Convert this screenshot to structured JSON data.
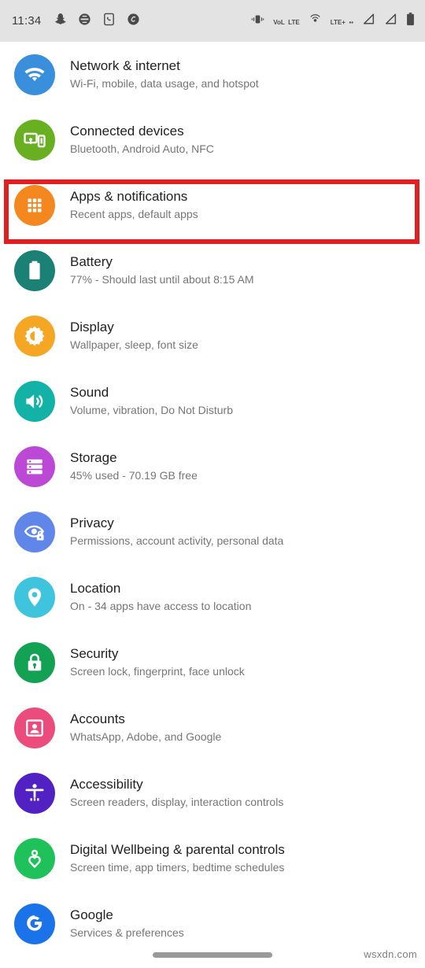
{
  "status_bar": {
    "time": "11:34",
    "left_icons": [
      "snapchat-icon",
      "print-icon",
      "phone-call-icon",
      "shazam-icon"
    ],
    "right_icons": [
      "vibrate-icon",
      "volte-icon",
      "hotspot-icon",
      "lte-plus-icon",
      "signal-sim1-icon",
      "signal-sim2-icon",
      "battery-icon"
    ],
    "volte_top": "VoL",
    "volte_bottom": "LTE",
    "lte_label": "LTE+"
  },
  "highlight": {
    "color": "#e02020",
    "target": "Apps & notifications"
  },
  "settings": {
    "items": [
      {
        "id": "network-internet",
        "title": "Network & internet",
        "subtitle": "Wi-Fi, mobile, data usage, and hotspot",
        "icon": "wifi-icon",
        "color": "#3a8fdd"
      },
      {
        "id": "connected-devices",
        "title": "Connected devices",
        "subtitle": "Bluetooth, Android Auto, NFC",
        "icon": "devices-icon",
        "color": "#68b021"
      },
      {
        "id": "apps-notifications",
        "title": "Apps & notifications",
        "subtitle": "Recent apps, default apps",
        "icon": "apps-grid-icon",
        "color": "#f4881f"
      },
      {
        "id": "battery",
        "title": "Battery",
        "subtitle": "77% - Should last until about 8:15 AM",
        "icon": "battery-icon",
        "color": "#1c8175"
      },
      {
        "id": "display",
        "title": "Display",
        "subtitle": "Wallpaper, sleep, font size",
        "icon": "brightness-icon",
        "color": "#f5a623"
      },
      {
        "id": "sound",
        "title": "Sound",
        "subtitle": "Volume, vibration, Do Not Disturb",
        "icon": "speaker-icon",
        "color": "#12b2a6"
      },
      {
        "id": "storage",
        "title": "Storage",
        "subtitle": "45% used - 70.19 GB free",
        "icon": "storage-icon",
        "color": "#bc49d6"
      },
      {
        "id": "privacy",
        "title": "Privacy",
        "subtitle": "Permissions, account activity, personal data",
        "icon": "eye-lock-icon",
        "color": "#5f86e8"
      },
      {
        "id": "location",
        "title": "Location",
        "subtitle": "On - 34 apps have access to location",
        "icon": "location-pin-icon",
        "color": "#3fc4dd"
      },
      {
        "id": "security",
        "title": "Security",
        "subtitle": "Screen lock, fingerprint, face unlock",
        "icon": "lock-icon",
        "color": "#13a254"
      },
      {
        "id": "accounts",
        "title": "Accounts",
        "subtitle": "WhatsApp, Adobe, and Google",
        "icon": "account-card-icon",
        "color": "#ec4b7e"
      },
      {
        "id": "accessibility",
        "title": "Accessibility",
        "subtitle": "Screen readers, display, interaction controls",
        "icon": "accessibility-icon",
        "color": "#5221c4"
      },
      {
        "id": "digital-wellbeing",
        "title": "Digital Wellbeing & parental controls",
        "subtitle": "Screen time, app timers, bedtime schedules",
        "icon": "wellbeing-heart-icon",
        "color": "#1fc25a"
      },
      {
        "id": "google",
        "title": "Google",
        "subtitle": "Services & preferences",
        "icon": "google-g-icon",
        "color": "#1a73e8"
      }
    ]
  },
  "nav_bar": {
    "handle": "gesture-handle"
  },
  "watermark": {
    "text": "wsxdn.com"
  }
}
